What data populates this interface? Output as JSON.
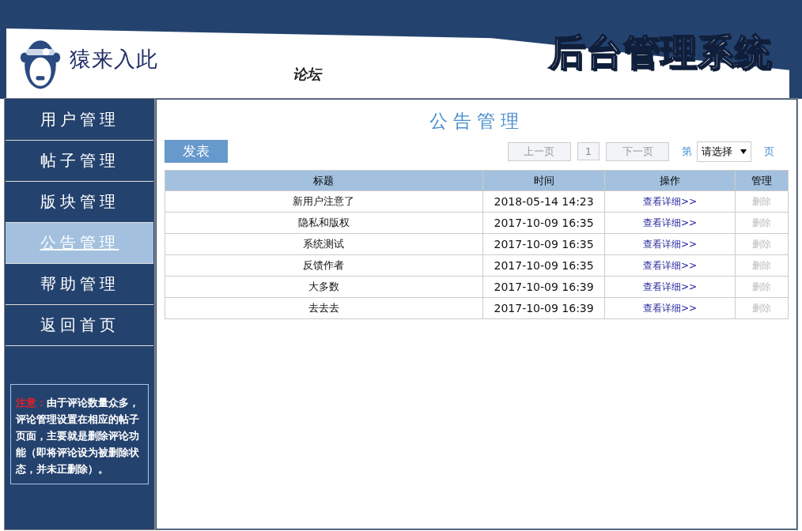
{
  "header": {
    "brand": "猿来入此",
    "section": "论坛",
    "system_title": "后台管理系统"
  },
  "sidebar": {
    "items": [
      {
        "label": "用户管理",
        "selected": false
      },
      {
        "label": "帖子管理",
        "selected": false
      },
      {
        "label": "版块管理",
        "selected": false
      },
      {
        "label": "公告管理",
        "selected": true
      },
      {
        "label": "帮助管理",
        "selected": false
      },
      {
        "label": "返回首页",
        "selected": false
      }
    ],
    "note": {
      "label": "注意：",
      "text": "由于评论数量众多，评论管理设置在相应的帖子页面，主要就是删除评论功能（即将评论设为被删除状态，并未正删除）。"
    }
  },
  "main": {
    "title": "公告管理",
    "publish_button": "发表",
    "pager": {
      "prev": {
        "label": "上一页",
        "disabled": true
      },
      "page": "1",
      "next": {
        "label": "下一页",
        "disabled": true
      },
      "prefix": "第",
      "select": "请选择",
      "suffix": "页"
    },
    "table": {
      "columns": [
        "标题",
        "时间",
        "操作",
        "管理"
      ],
      "rows": [
        {
          "title": "新用户注意了",
          "time": "2018-05-14 14:23",
          "action": "查看详细>>",
          "delete": {
            "label": "删除",
            "disabled": true
          }
        },
        {
          "title": "隐私和版权",
          "time": "2017-10-09 16:35",
          "action": "查看详细>>",
          "delete": {
            "label": "删除",
            "disabled": true
          }
        },
        {
          "title": "系统测试",
          "time": "2017-10-09 16:35",
          "action": "查看详细>>",
          "delete": {
            "label": "删除",
            "disabled": true
          }
        },
        {
          "title": "反馈作者",
          "time": "2017-10-09 16:35",
          "action": "查看详细>>",
          "delete": {
            "label": "删除",
            "disabled": true
          }
        },
        {
          "title": "大多数",
          "time": "2017-10-09 16:39",
          "action": "查看详细>>",
          "delete": {
            "label": "删除",
            "disabled": true
          }
        },
        {
          "title": "去去去",
          "time": "2017-10-09 16:39",
          "action": "查看详细>>",
          "delete": {
            "label": "删除",
            "disabled": true
          }
        }
      ]
    }
  }
}
